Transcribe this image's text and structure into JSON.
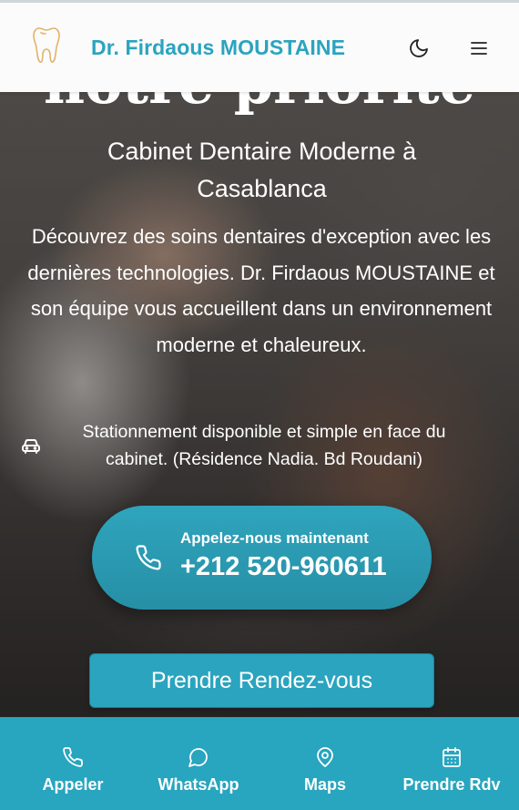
{
  "header": {
    "brand": "Dr. Firdaous MOUSTAINE",
    "icons": [
      "tooth-logo-icon",
      "moon-icon",
      "menu-icon"
    ]
  },
  "hero": {
    "title_partial": "notre priorité",
    "subtitle": "Cabinet Dentaire Moderne à Casablanca",
    "description": "Découvrez des soins dentaires d'exception avec les dernières technologies. Dr. Firdaous MOUSTAINE et son équipe vous accueillent dans un environnement moderne et chaleureux.",
    "parking": "Stationnement disponible et simple en face du cabinet. (Résidence Nadia. Bd Roudani)",
    "call": {
      "label": "Appelez-nous maintenant",
      "number": "+212 520-960611"
    },
    "rdv_button": "Prendre Rendez-vous"
  },
  "bottom_nav": {
    "call": "Appeler",
    "whatsapp": "WhatsApp",
    "maps": "Maps",
    "rdv": "Prendre Rdv"
  },
  "colors": {
    "accent": "#2aa4bf",
    "header_bg": "#fbfbfb",
    "nav_bg": "#28a5bf"
  }
}
